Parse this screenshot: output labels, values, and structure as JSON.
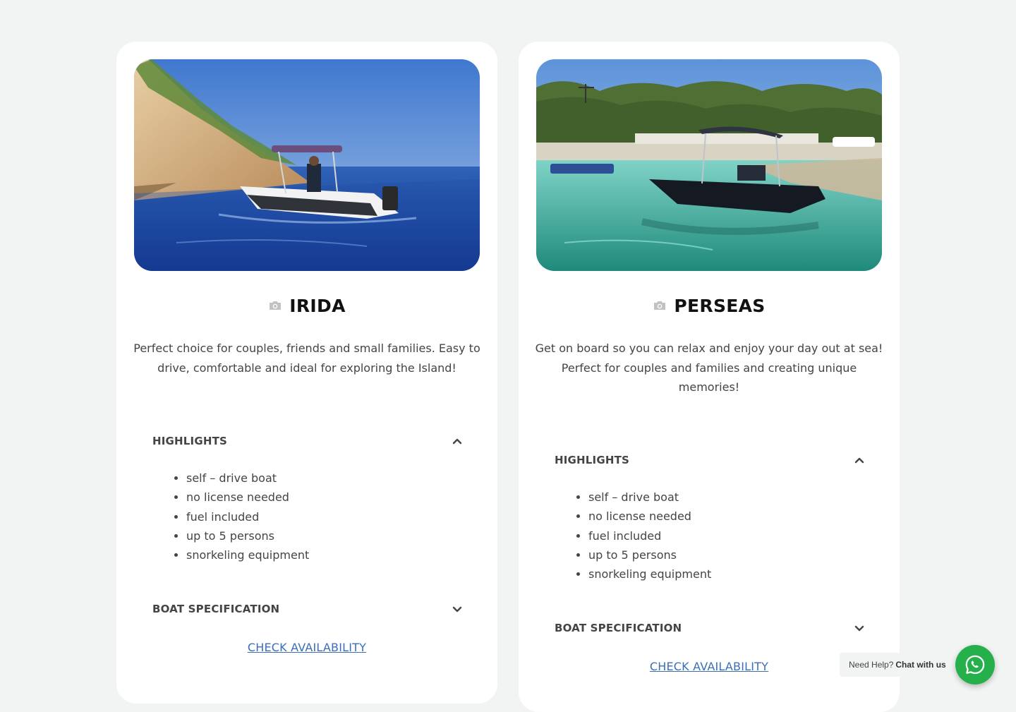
{
  "boats": [
    {
      "name": "IRIDA",
      "description": "Perfect choice for couples, friends and small families. Easy to drive, comfortable and ideal for exploring the Island!",
      "highlights_title": "HIGHLIGHTS",
      "highlights": [
        "self – drive boat",
        "no license needed",
        "fuel included",
        "up to 5 persons",
        "snorkeling equipment"
      ],
      "spec_title": "BOAT SPECIFICATION",
      "cta": "CHECK AVAILABILITY"
    },
    {
      "name": "PERSEAS",
      "description": "Get on board so you can relax and enjoy your day out at sea! Perfect for couples and families and creating unique memories!",
      "highlights_title": "HIGHLIGHTS",
      "highlights": [
        "self – drive boat",
        "no license needed",
        "fuel included",
        "up to 5 persons",
        "snorkeling equipment"
      ],
      "spec_title": "BOAT SPECIFICATION",
      "cta": "CHECK AVAILABILITY"
    }
  ],
  "whatsapp": {
    "prefix": "Need Help?",
    "action": "Chat with us",
    "icon": "whatsapp-icon",
    "color": "#25b04b"
  },
  "colors": {
    "link": "#3a6fb8",
    "background": "#f2f4f3",
    "card": "#ffffff"
  }
}
